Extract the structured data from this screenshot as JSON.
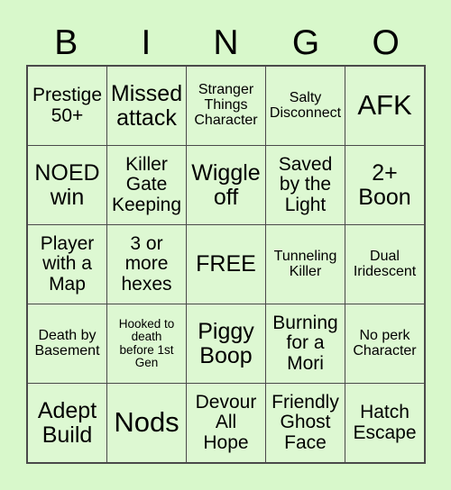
{
  "card": {
    "title": "BINGO",
    "background_color": "#d8f8cb",
    "cell_color": "#ddf8d2",
    "border_color": "#4a4a4a",
    "text_color": "#000000"
  },
  "header": {
    "letters": [
      "B",
      "I",
      "N",
      "G",
      "O"
    ]
  },
  "grid": {
    "rows": 5,
    "columns": 5,
    "free_space": "FREE",
    "cells": [
      {
        "text": "Prestige\n50+",
        "size": "md"
      },
      {
        "text": "Missed\nattack",
        "size": "lg"
      },
      {
        "text": "Stranger\nThings\nCharacter",
        "size": "sm"
      },
      {
        "text": "Salty\nDisconnect",
        "size": "sm"
      },
      {
        "text": "AFK",
        "size": "xl"
      },
      {
        "text": "NOED\nwin",
        "size": "lg"
      },
      {
        "text": "Killer\nGate\nKeeping",
        "size": "md"
      },
      {
        "text": "Wiggle\noff",
        "size": "lg"
      },
      {
        "text": "Saved\nby the\nLight",
        "size": "md"
      },
      {
        "text": "2+\nBoon",
        "size": "lg"
      },
      {
        "text": "Player\nwith a\nMap",
        "size": "md"
      },
      {
        "text": "3 or\nmore\nhexes",
        "size": "md"
      },
      {
        "text": "FREE",
        "size": "lg"
      },
      {
        "text": "Tunneling\nKiller",
        "size": "sm"
      },
      {
        "text": "Dual\nIridescent",
        "size": "sm"
      },
      {
        "text": "Death by\nBasement",
        "size": "sm"
      },
      {
        "text": "Hooked to\ndeath\nbefore 1st\nGen",
        "size": "xs"
      },
      {
        "text": "Piggy\nBoop",
        "size": "lg"
      },
      {
        "text": "Burning\nfor a\nMori",
        "size": "md"
      },
      {
        "text": "No perk\nCharacter",
        "size": "sm"
      },
      {
        "text": "Adept\nBuild",
        "size": "lg"
      },
      {
        "text": "Nods",
        "size": "xl"
      },
      {
        "text": "Devour\nAll\nHope",
        "size": "md"
      },
      {
        "text": "Friendly\nGhost\nFace",
        "size": "md"
      },
      {
        "text": "Hatch\nEscape",
        "size": "md"
      }
    ]
  }
}
